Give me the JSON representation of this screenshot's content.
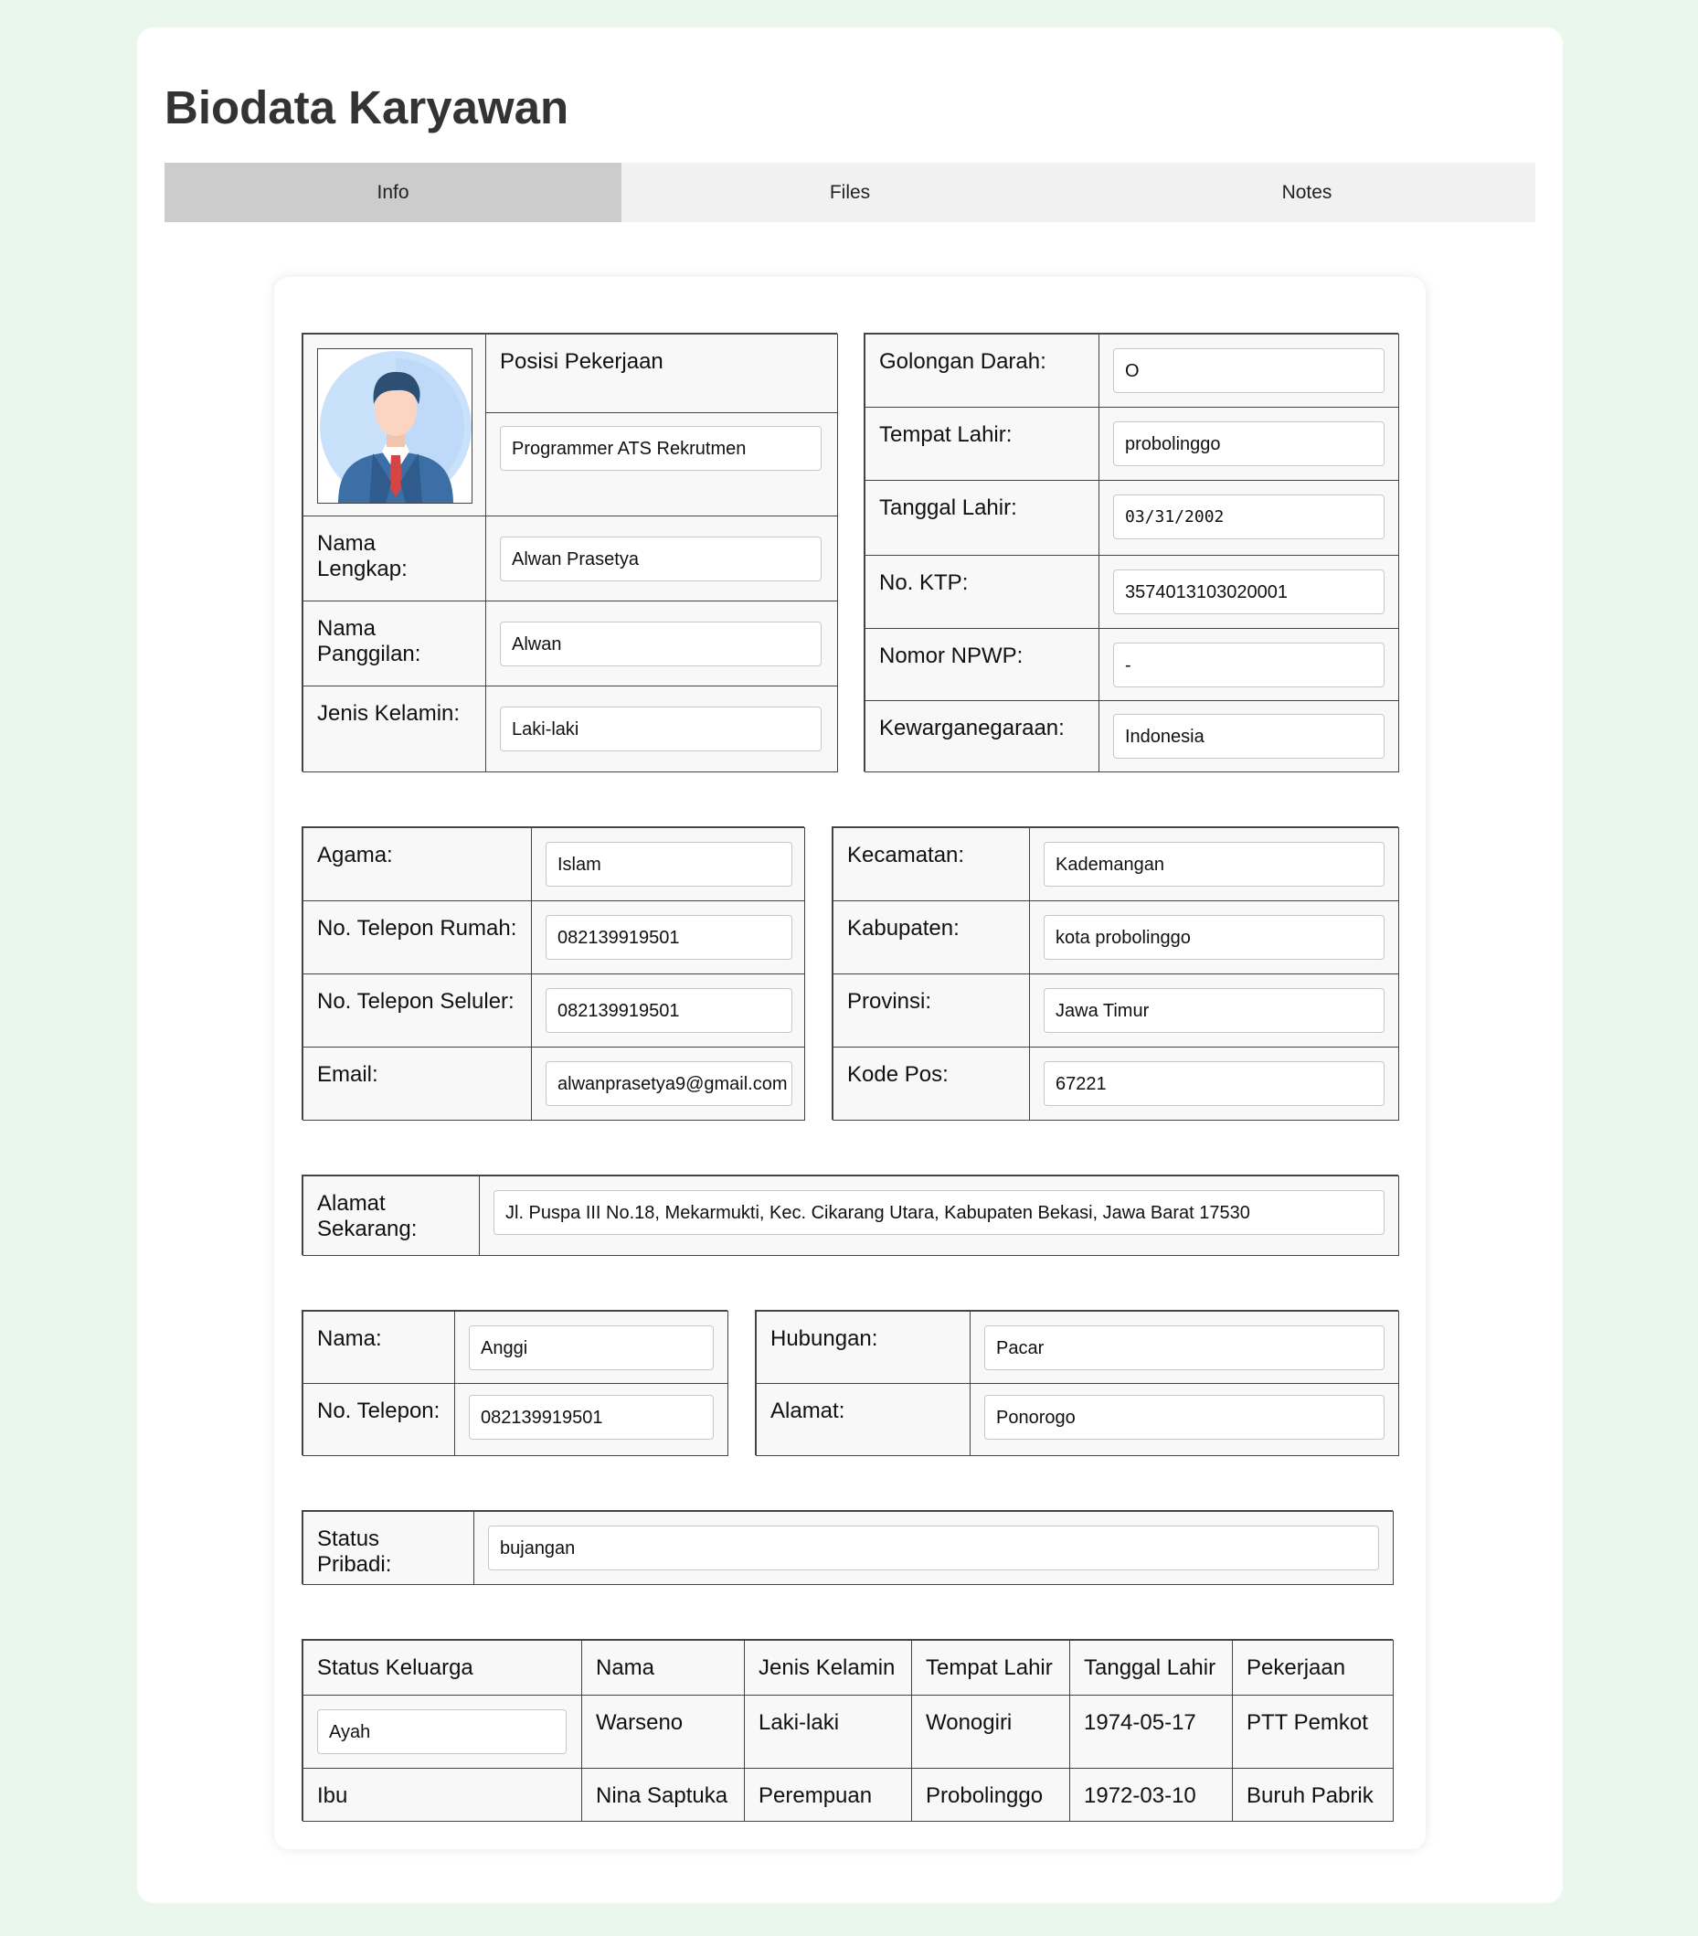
{
  "page_title": "Biodata Karyawan",
  "tabs": [
    {
      "label": "Info",
      "active": true
    },
    {
      "label": "Files",
      "active": false
    },
    {
      "label": "Notes",
      "active": false
    }
  ],
  "profile": {
    "position_label": "Posisi Pekerjaan",
    "position_value": "Programmer ATS Rekrutmen",
    "fullname_label": "Nama Lengkap:",
    "fullname_value": "Alwan Prasetya",
    "nickname_label": "Nama Panggilan:",
    "nickname_value": "Alwan",
    "gender_label": "Jenis Kelamin:",
    "gender_value": "Laki-laki"
  },
  "identity": {
    "blood_label": "Golongan Darah:",
    "blood_value": "O",
    "birthplace_label": "Tempat Lahir:",
    "birthplace_value": "probolinggo",
    "birthdate_label": "Tanggal Lahir:",
    "birthdate_value": "03/31/2002",
    "ktp_label": "No. KTP:",
    "ktp_value": "3574013103020001",
    "npwp_label": "Nomor NPWP:",
    "npwp_value": "-",
    "citizenship_label": "Kewarganegaraan:",
    "citizenship_value": "Indonesia"
  },
  "contact": {
    "religion_label": "Agama:",
    "religion_value": "Islam",
    "home_phone_label": "No. Telepon Rumah:",
    "home_phone_value": "082139919501",
    "mobile_label": "No. Telepon Seluler:",
    "mobile_value": "082139919501",
    "email_label": "Email:",
    "email_value": "alwanprasetya9@gmail.com"
  },
  "region": {
    "district_label": "Kecamatan:",
    "district_value": "Kademangan",
    "regency_label": "Kabupaten:",
    "regency_value": "kota probolinggo",
    "province_label": "Provinsi:",
    "province_value": "Jawa Timur",
    "postal_label": "Kode Pos:",
    "postal_value": "67221"
  },
  "address": {
    "label": "Alamat Sekarang:",
    "value": "Jl. Puspa III No.18, Mekarmukti, Kec. Cikarang Utara, Kabupaten Bekasi, Jawa Barat 17530"
  },
  "emergency": {
    "name_label": "Nama:",
    "name_value": "Anggi",
    "phone_label": "No. Telepon:",
    "phone_value": "082139919501",
    "relation_label": "Hubungan:",
    "relation_value": "Pacar",
    "address_label": "Alamat:",
    "address_value": "Ponorogo"
  },
  "personal_status": {
    "label": "Status Pribadi:",
    "value": "bujangan"
  },
  "family": {
    "headers": [
      "Status Keluarga",
      "Nama",
      "Jenis Kelamin",
      "Tempat Lahir",
      "Tanggal Lahir",
      "Pekerjaan"
    ],
    "rows": [
      [
        "Ayah",
        "Warseno",
        "Laki-laki",
        "Wonogiri",
        "1974-05-17",
        "PTT Pemkot"
      ],
      [
        "Ibu",
        "Nina Saptuka",
        "Perempuan",
        "Probolinggo",
        "1972-03-10",
        "Buruh Pabrik"
      ]
    ]
  }
}
